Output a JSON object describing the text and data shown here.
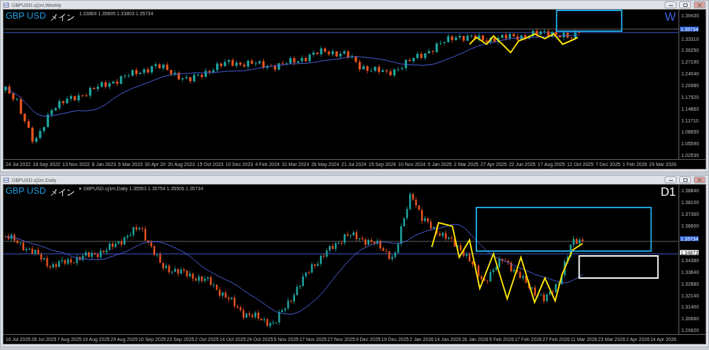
{
  "windows": [
    {
      "title": "GBPUSD.oj1m,Weekly",
      "info": "1.33869 1.35895 1.33803 1.35734",
      "symbol": "GBP USD",
      "label": "メイン",
      "timeframe": "W",
      "color": "#3a5fd8",
      "price_ticks": [
        "1.39430",
        "1.33310",
        "1.30250",
        "1.27190",
        "1.24040",
        "1.20980",
        "1.17920",
        "1.14860",
        "1.11710",
        "1.08650",
        "1.05590",
        "1.02530"
      ],
      "markers": [
        {
          "kind": "bid",
          "text": "1.35734"
        }
      ],
      "dates": [
        "24 Jul 2022",
        "18 Sep 2022",
        "13 Nov 2022",
        "8 Jan 2023",
        "5 Mar 2023",
        "30 Apr 20",
        "20 Aug 2023",
        "15 Oct 2023",
        "10 Dec 2023",
        "4 Feb 2024",
        "31 Mar 2024",
        "26 May 2024",
        "21 Jul 2024",
        "15 Sep 2024",
        "10 Nov 2024",
        "5 Jan 2025",
        "2 Mar 2025",
        "27 Apr 2025",
        "22 Jun 2025",
        "17 Aug 2025",
        "12 Oct 2025",
        "7 Dec 2025",
        "1 Feb 2026",
        "29 Mar 2026"
      ]
    },
    {
      "title": "GBPUSD.oj1m,Daily",
      "info": "▾ GBPUSD.oj1m,Daily 1.35553 1.35754 1.35506 1.35734",
      "symbol": "GBP USD",
      "label": "メイン",
      "timeframe": "D1",
      "color": "#ffffff",
      "price_ticks": [
        "1.38840",
        "1.38100",
        "1.37360",
        "1.36600",
        "1.34380",
        "1.33640",
        "1.32880",
        "1.32140",
        "1.31400",
        "1.30660",
        "1.29920"
      ],
      "markers": [
        {
          "kind": "bid",
          "text": "1.35734"
        },
        {
          "kind": "line",
          "text": "1.34873"
        }
      ],
      "dates": [
        "16 Jul 2025",
        "28 Jul 2025",
        "7 Aug 2025",
        "19 Aug 2025",
        "29 Aug 2025",
        "10 Sep 2025",
        "22 Sep 2025",
        "2 Oct 2025",
        "14 Oct 2025",
        "24 Oct 2025",
        "5 Nov 2025",
        "17 Nov 2025",
        "27 Nov 2025",
        "9 Dec 2025",
        "19 Dec 2025",
        "2 Jan 2026",
        "14 Jan 2026",
        "26 Jan 2026",
        "5 Feb 2026",
        "17 Feb 2026",
        "27 Feb 2026",
        "11 Mar 2026",
        "23 Mar 2026",
        "2 Apr 2026",
        "14 Apr 2026"
      ]
    }
  ]
}
